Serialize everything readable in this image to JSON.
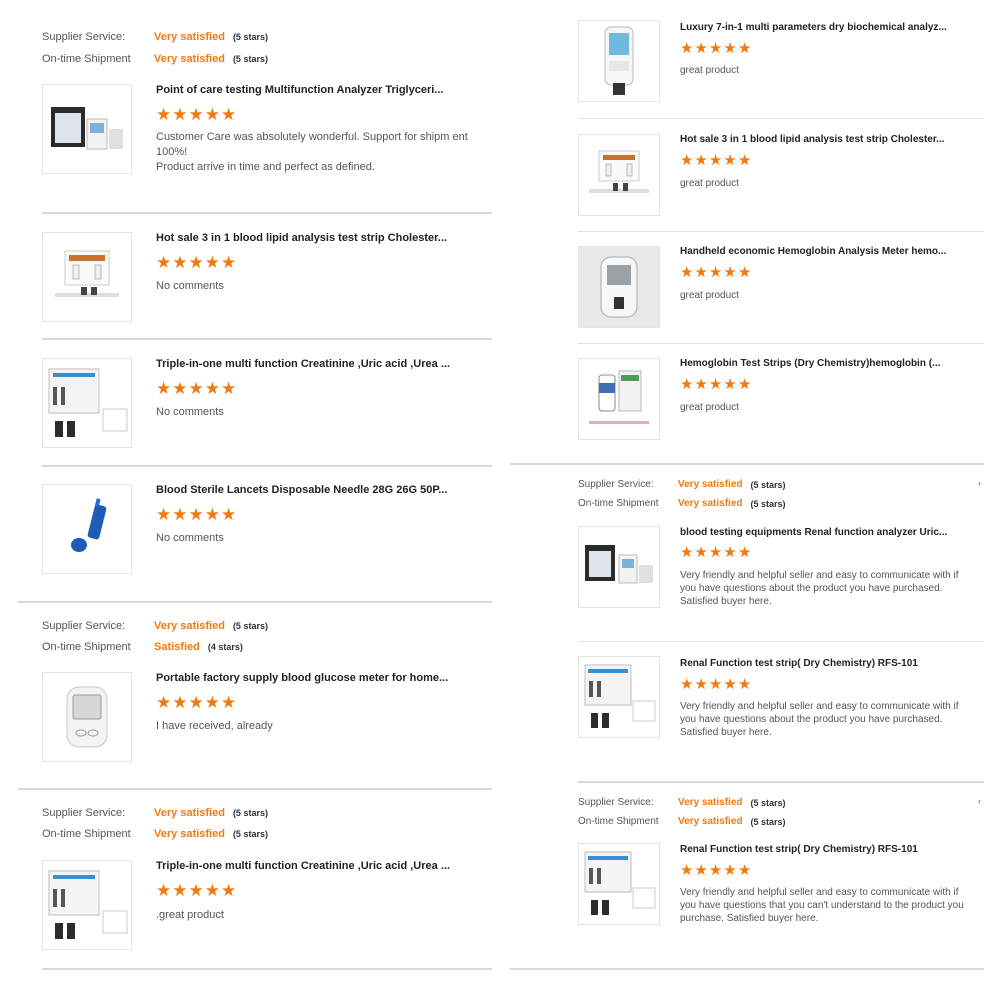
{
  "labels": {
    "supplier_service": "Supplier Service:",
    "on_time_shipment": "On-time Shipment"
  },
  "colors": {
    "accent": "#f07a12",
    "divider": "#d9d9d9"
  },
  "left": {
    "group1": {
      "supplier_value": "Very satisfied",
      "supplier_count": "(5 stars)",
      "shipment_value": "Very satisfied",
      "shipment_count": "(5 stars)",
      "items": [
        {
          "title": "Point of care testing Multifunction Analyzer Triglyceri...",
          "comment": "Customer Care was absolutely wonderful. Support for shipm ent 100%!\nProduct arrive in time and perfect as defined.",
          "stars": 5,
          "icon": "analyzer-kit-image"
        },
        {
          "title": "Hot sale 3 in 1 blood lipid analysis test strip Cholester...",
          "comment": "No comments",
          "stars": 5,
          "icon": "test-strip-kit-image"
        },
        {
          "title": "Triple-in-one multi function Creatinine ,Uric acid ,Urea ...",
          "comment": "No comments",
          "stars": 5,
          "icon": "product-box-image"
        },
        {
          "title": "Blood Sterile Lancets Disposable Needle 28G 26G 50P...",
          "comment": "No comments",
          "stars": 5,
          "icon": "lancet-image"
        }
      ]
    },
    "group2": {
      "supplier_value": "Very satisfied",
      "supplier_count": "(5 stars)",
      "shipment_value": "Satisfied",
      "shipment_count": "(4 stars)",
      "items": [
        {
          "title": "Portable factory supply blood glucose meter for home...",
          "comment": "I have received, already",
          "stars": 5,
          "icon": "glucose-meter-image"
        }
      ]
    },
    "group3": {
      "supplier_value": "Very satisfied",
      "supplier_count": "(5 stars)",
      "shipment_value": "Very satisfied",
      "shipment_count": "(5 stars)",
      "items": [
        {
          "title": "Triple-in-one multi function Creatinine ,Uric acid ,Urea ...",
          "comment": ".great product",
          "stars": 5,
          "icon": "product-box-image"
        }
      ]
    }
  },
  "right": {
    "group1": {
      "items": [
        {
          "title": "Luxury 7-in-1 multi parameters dry biochemical analyz...",
          "comment": "great product",
          "stars": 5,
          "icon": "handheld-analyzer-image"
        },
        {
          "title": "Hot sale 3 in 1 blood lipid analysis test strip Cholester...",
          "comment": "great product",
          "stars": 5,
          "icon": "test-strip-kit-image"
        },
        {
          "title": "Handheld economic Hemoglobin Analysis Meter hemo...",
          "comment": "great product",
          "stars": 5,
          "icon": "hemoglobin-meter-image"
        },
        {
          "title": "Hemoglobin Test Strips (Dry Chemistry)hemoglobin (...",
          "comment": "great product",
          "stars": 5,
          "icon": "strip-bottle-image"
        }
      ]
    },
    "group2": {
      "supplier_value": "Very satisfied",
      "supplier_count": "(5 stars)",
      "shipment_value": "Very satisfied",
      "shipment_count": "(5 stars)",
      "items": [
        {
          "title": "blood testing equipments Renal function analyzer Uric...",
          "comment": "Very friendly and helpful seller and easy to communicate with if you have questions about the product you have purchased. Satisfied buyer here.",
          "stars": 5,
          "icon": "analyzer-kit-image"
        },
        {
          "title": "Renal Function test strip( Dry Chemistry) RFS-101",
          "comment": "Very friendly and helpful seller and easy to communicate with if you have questions about the product you have purchased. Satisfied buyer here.",
          "stars": 5,
          "icon": "product-box-image"
        }
      ]
    },
    "group3": {
      "supplier_value": "Very satisfied",
      "supplier_count": "(5 stars)",
      "shipment_value": "Very satisfied",
      "shipment_count": "(5 stars)",
      "items": [
        {
          "title": "Renal Function test strip( Dry Chemistry) RFS-101",
          "comment": "Very friendly and helpful seller and easy to communicate with if you have questions that you can't understand to the product you purchase. Satisfied buyer here.",
          "stars": 5,
          "icon": "product-box-image"
        }
      ]
    }
  }
}
